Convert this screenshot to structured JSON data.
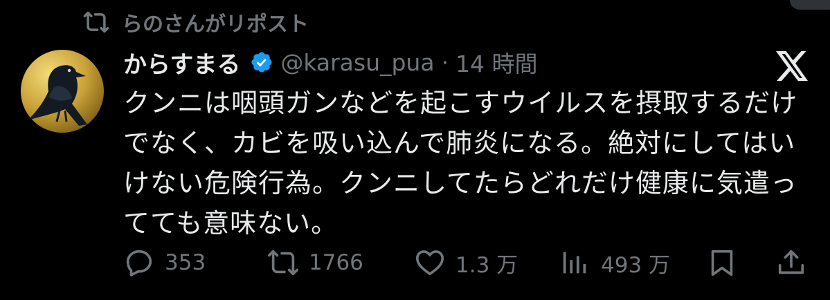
{
  "repost": {
    "text": "らのさんがリポスト"
  },
  "tweet": {
    "display_name": "からすまる",
    "handle": "@karasu_pua",
    "separator": "·",
    "time": "14 時間",
    "text_lines": [
      "クンニは咽頭ガンなどを起こすウイルスを摂取するだけ",
      "でなく、カビを吸い込んで肺炎になる。絶対にしてはい",
      "けない危険行為。クンニしてたらどれだけ健康に気遣っ",
      "てても意味ない。"
    ]
  },
  "actions": {
    "replies": "353",
    "reposts": "1766",
    "likes": "1.3 万",
    "views": "493 万"
  },
  "colors": {
    "background": "#000000",
    "text_primary": "#e7e9ea",
    "text_secondary": "#71767b",
    "verified": "#1d9bf0"
  },
  "icons": {
    "repost": "repost-icon",
    "verified": "verified-badge-icon",
    "brand": "x-logo-icon",
    "reply": "reply-icon",
    "like": "heart-icon",
    "views": "views-chart-icon",
    "bookmark": "bookmark-icon",
    "share": "share-icon"
  }
}
